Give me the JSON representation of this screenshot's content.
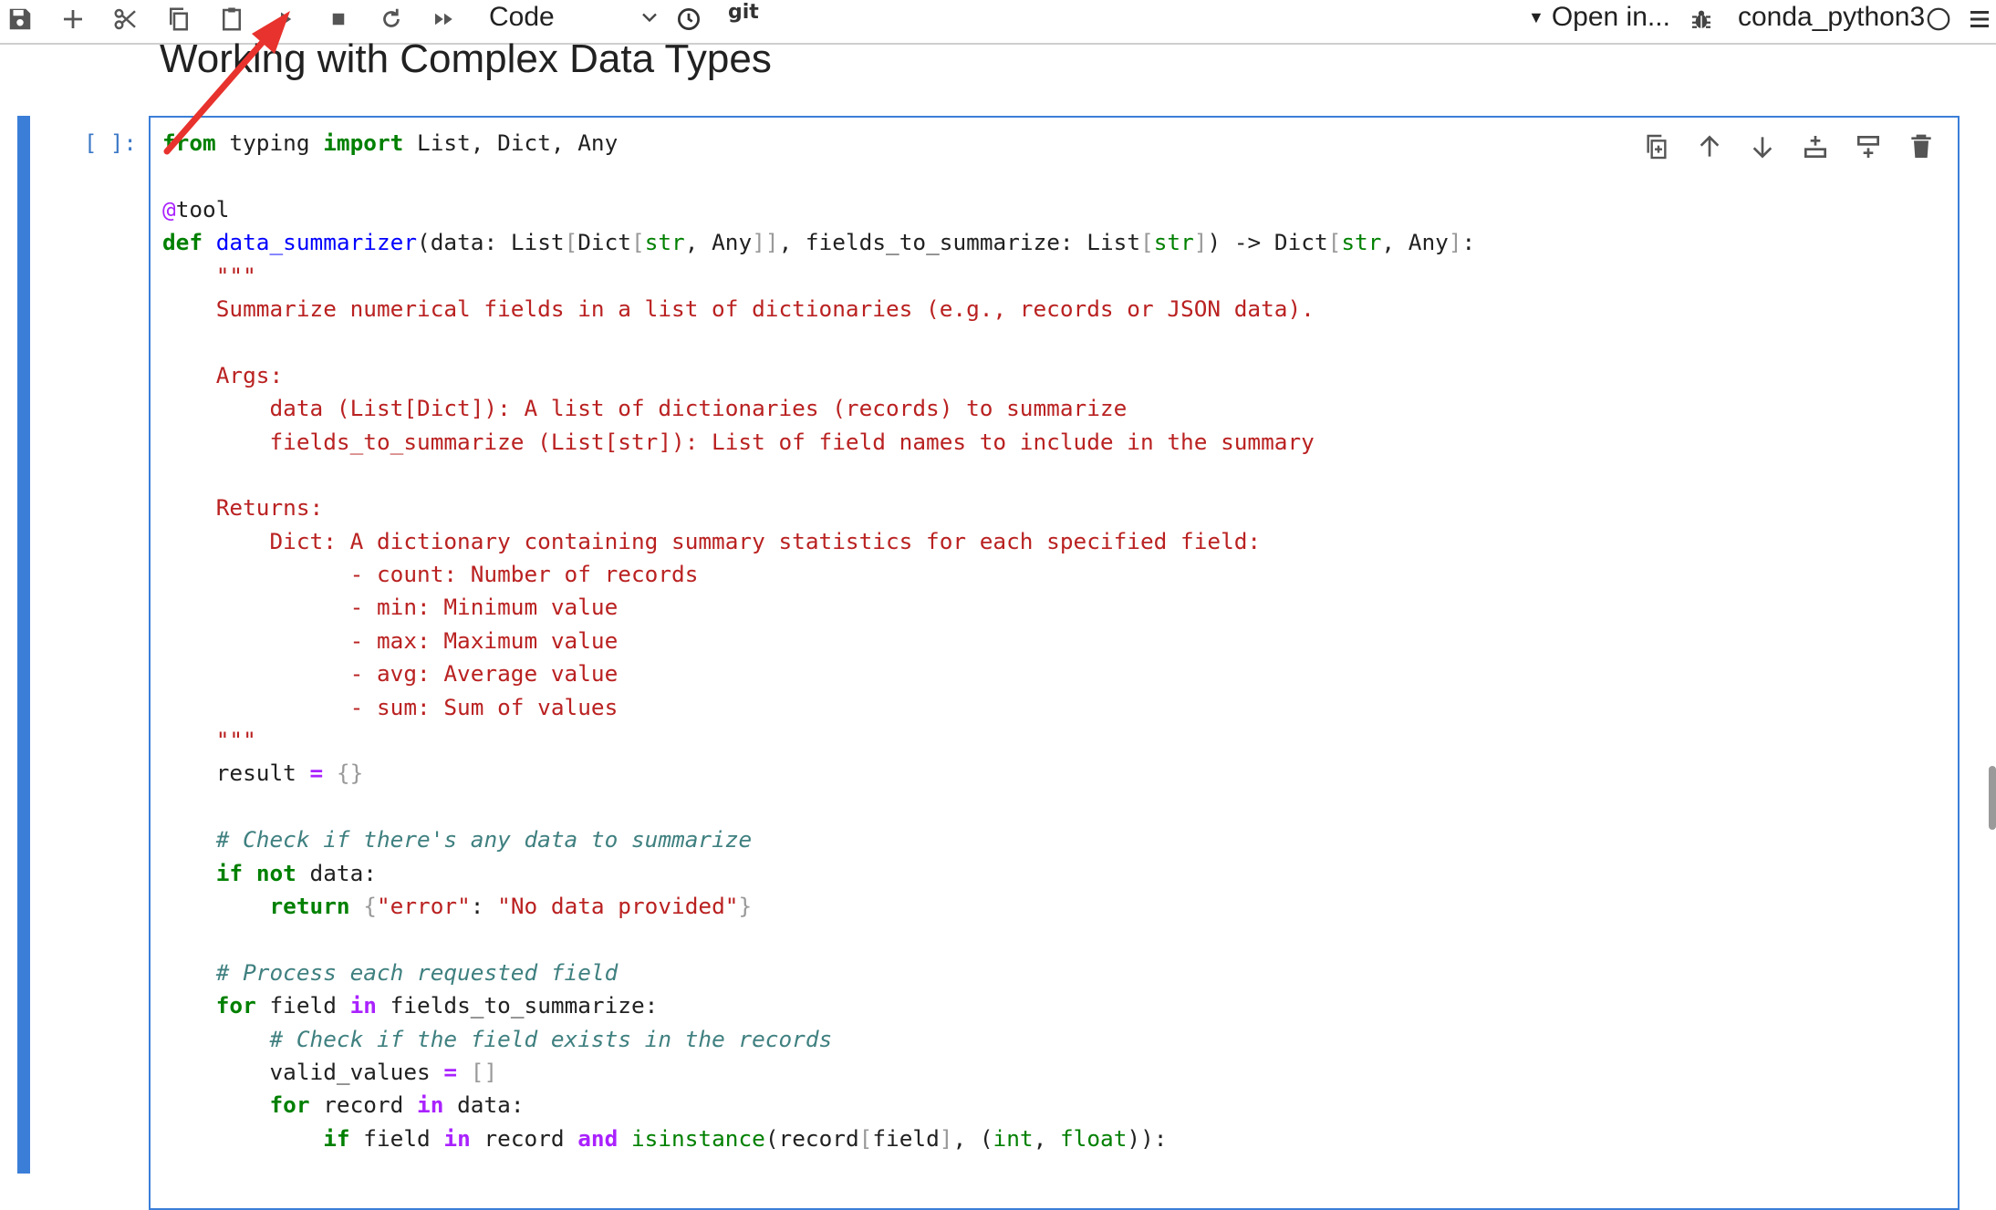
{
  "toolbar": {
    "buttons": [
      {
        "id": "save",
        "icon": "save-icon"
      },
      {
        "id": "insert",
        "icon": "plus-icon"
      },
      {
        "id": "cut",
        "icon": "scissors-icon"
      },
      {
        "id": "copy",
        "icon": "copy-icon"
      },
      {
        "id": "paste",
        "icon": "clipboard-icon"
      },
      {
        "id": "run",
        "icon": "play-icon"
      },
      {
        "id": "interrupt",
        "icon": "stop-icon"
      },
      {
        "id": "restart",
        "icon": "restart-icon"
      },
      {
        "id": "restart-run-all",
        "icon": "fast-forward-icon"
      }
    ],
    "cell_type": "Code",
    "git_label": "git",
    "open_in_label": "Open in...",
    "kernel_name": "conda_python3"
  },
  "notebook": {
    "heading": "Working with Complex Data Types",
    "cell": {
      "prompt": "[ ]:",
      "tools": [
        "duplicate-icon",
        "move-up-icon",
        "move-down-icon",
        "insert-above-icon",
        "insert-below-icon",
        "delete-icon"
      ],
      "lines": [
        "from typing import List, Dict, Any",
        "",
        "@tool",
        "def data_summarizer(data: List[Dict[str, Any]], fields_to_summarize: List[str]) -> Dict[str, Any]:",
        "    \"\"\"",
        "    Summarize numerical fields in a list of dictionaries (e.g., records or JSON data).",
        "",
        "    Args:",
        "        data (List[Dict]): A list of dictionaries (records) to summarize",
        "        fields_to_summarize (List[str]): List of field names to include in the summary",
        "",
        "    Returns:",
        "        Dict: A dictionary containing summary statistics for each specified field:",
        "              - count: Number of records",
        "              - min: Minimum value",
        "              - max: Maximum value",
        "              - avg: Average value",
        "              - sum: Sum of values",
        "    \"\"\"",
        "    result = {}",
        "",
        "    # Check if there's any data to summarize",
        "    if not data:",
        "        return {\"error\": \"No data provided\"}",
        "",
        "    # Process each requested field",
        "    for field in fields_to_summarize:",
        "        # Check if the field exists in the records",
        "        valid_values = []",
        "        for record in data:",
        "            if field in record and isinstance(record[field], (int, float)):"
      ]
    }
  },
  "colors": {
    "accent": "#3b7ed8",
    "annotation_arrow": "#e8322d"
  }
}
